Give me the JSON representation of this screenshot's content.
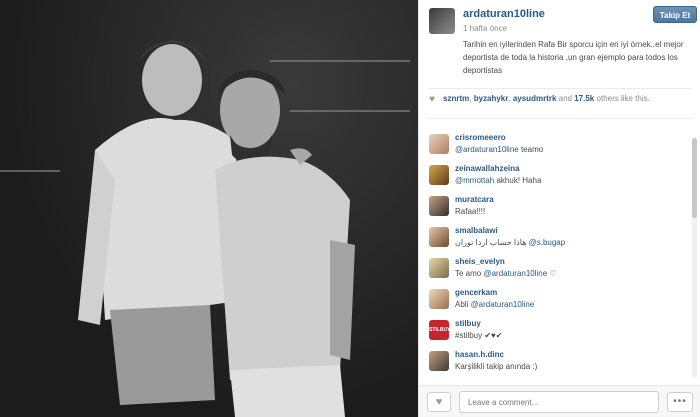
{
  "post": {
    "username": "ardaturan10line",
    "time": "1 hafta önce",
    "caption": "Tarihin en iyilerinden Rafa Bir sporcu için en iyi örnek..el mejor deportista de toda la historia ,un gran ejemplo para todos los deportistas",
    "follow_label": "Takip Et"
  },
  "likes": {
    "user1": "sznrtm",
    "user2": "byzahykr",
    "user3": "aysudmrtrk",
    "and_text": "and",
    "count": "17.5k",
    "suffix": "others like this."
  },
  "comments": [
    {
      "user": "crisromeeero",
      "mention": "@ardaturan10line",
      "text": " teamo"
    },
    {
      "user": "zeinawallahzeina",
      "mention": "@mmottah",
      "text": " akhuk! Haha"
    },
    {
      "user": "muratcara",
      "mention": "",
      "text": "Rafaa!!!!"
    },
    {
      "user": "smalbalawi",
      "mention": "@s.bugap",
      "text": "هاذا حساب اردا توران "
    },
    {
      "user": "sheis_evelyn",
      "mention": "@ardaturan10line",
      "text": "Te amo "
    },
    {
      "user": "gencerkam",
      "mention": "@ardaturan10line",
      "text": "Abli "
    },
    {
      "user": "stilbuy",
      "mention": "",
      "text": "#stilbuy ✔♥✔"
    },
    {
      "user": "hasan.h.dinc",
      "mention": "",
      "text": "Karşilikli takip anında :)"
    }
  ],
  "comment_suffix": {
    "heart": "♡"
  },
  "footer": {
    "placeholder": "Leave a comment...",
    "more": "•••"
  },
  "icons": {
    "heart": "heart-icon",
    "more": "ellipsis-icon"
  }
}
